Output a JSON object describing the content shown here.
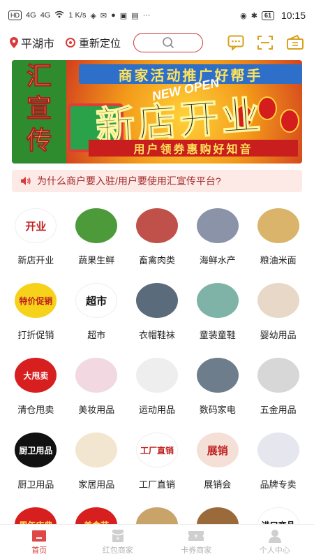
{
  "status_bar": {
    "network_badge": "HD",
    "signal1": "4G",
    "signal2": "4G",
    "speed": "1 K/s",
    "battery": "61",
    "time": "10:15"
  },
  "header": {
    "city": "平湖市",
    "relocate_label": "重新定位",
    "search_placeholder": ""
  },
  "banner": {
    "left_text": [
      "汇",
      "宣",
      "传"
    ],
    "top_text": "商家活动推广好帮手",
    "big_text": "新店开业",
    "newopen_text": "NEW OPEN",
    "bottom_text": "用户领券惠购好知音"
  },
  "notice": {
    "text": "为什么商户要入驻/用户要使用汇宣传平台?"
  },
  "categories": [
    {
      "label": "新店开业",
      "thumb_text": "开业",
      "color": "#ffffff",
      "text_color": "#c0201f"
    },
    {
      "label": "蔬果生鲜",
      "thumb_text": "",
      "color": "#4c9a3a",
      "text_color": "#ffffff"
    },
    {
      "label": "畜禽肉类",
      "thumb_text": "",
      "color": "#c0504a",
      "text_color": "#ffffff"
    },
    {
      "label": "海鲜水产",
      "thumb_text": "",
      "color": "#8a93a8",
      "text_color": "#ffffff"
    },
    {
      "label": "粮油米面",
      "thumb_text": "",
      "color": "#d9b46a",
      "text_color": "#ffffff"
    },
    {
      "label": "打折促销",
      "thumb_text": "特价促销",
      "color": "#f6d21a",
      "text_color": "#c0201f"
    },
    {
      "label": "超市",
      "thumb_text": "超市",
      "color": "#ffffff",
      "text_color": "#111111"
    },
    {
      "label": "衣帽鞋袜",
      "thumb_text": "",
      "color": "#5a6b7c",
      "text_color": "#ffffff"
    },
    {
      "label": "童装童鞋",
      "thumb_text": "",
      "color": "#7fb3a7",
      "text_color": "#ffffff"
    },
    {
      "label": "婴幼用品",
      "thumb_text": "",
      "color": "#e8d8c8",
      "text_color": "#ffffff"
    },
    {
      "label": "清仓甩卖",
      "thumb_text": "大甩卖",
      "color": "#d81f1f",
      "text_color": "#ffffff"
    },
    {
      "label": "美妆用品",
      "thumb_text": "",
      "color": "#f2d8e0",
      "text_color": "#ffffff"
    },
    {
      "label": "运动用品",
      "thumb_text": "",
      "color": "#eeeeee",
      "text_color": "#ffffff"
    },
    {
      "label": "数码家电",
      "thumb_text": "",
      "color": "#6d7d8c",
      "text_color": "#ffffff"
    },
    {
      "label": "五金用品",
      "thumb_text": "",
      "color": "#d7d7d7",
      "text_color": "#ffffff"
    },
    {
      "label": "厨卫用品",
      "thumb_text": "厨卫用品",
      "color": "#111111",
      "text_color": "#ffffff"
    },
    {
      "label": "家居用品",
      "thumb_text": "",
      "color": "#f3e6d0",
      "text_color": "#ffffff"
    },
    {
      "label": "工厂直销",
      "thumb_text": "工厂直销",
      "color": "#ffffff",
      "text_color": "#c0201f"
    },
    {
      "label": "展销会",
      "thumb_text": "展销",
      "color": "#f5e0d8",
      "text_color": "#c0201f"
    },
    {
      "label": "品牌专卖",
      "thumb_text": "",
      "color": "#e6e6ee",
      "text_color": "#ffffff"
    },
    {
      "label": "",
      "thumb_text": "周年庆典",
      "color": "#d81f1f",
      "text_color": "#ffe35a"
    },
    {
      "label": "",
      "thumb_text": "美食节",
      "color": "#d81f1f",
      "text_color": "#ffe35a"
    },
    {
      "label": "",
      "thumb_text": "",
      "color": "#c8a46a",
      "text_color": "#ffffff"
    },
    {
      "label": "",
      "thumb_text": "",
      "color": "#9a6a3a",
      "text_color": "#ffffff"
    },
    {
      "label": "",
      "thumb_text": "进口商品",
      "color": "#ffffff",
      "text_color": "#111111"
    }
  ],
  "bottom_nav": [
    {
      "label": "首页",
      "icon": "home-icon",
      "active": true
    },
    {
      "label": "红包商家",
      "icon": "red-packet-icon",
      "active": false
    },
    {
      "label": "卡券商家",
      "icon": "coupon-icon",
      "active": false
    },
    {
      "label": "个人中心",
      "icon": "user-icon",
      "active": false
    }
  ],
  "colors": {
    "accent": "#d83a3a",
    "notice_bg": "#fde9e6",
    "inactive": "#b5b5b5"
  }
}
